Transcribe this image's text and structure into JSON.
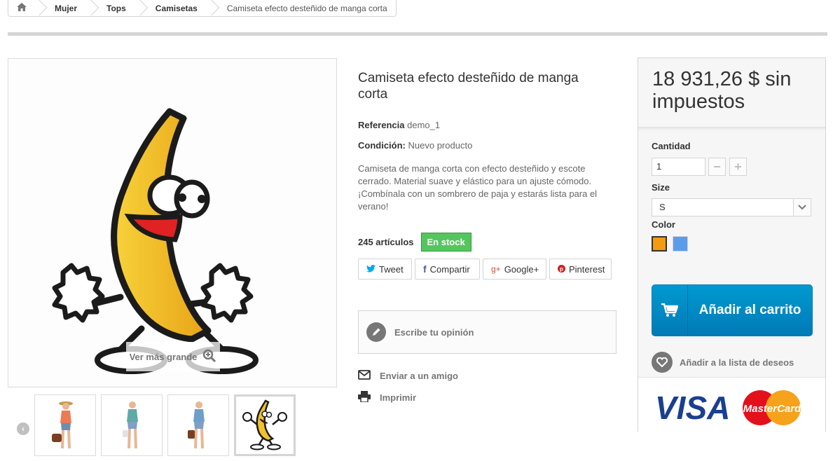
{
  "breadcrumb": {
    "home_icon": "home-icon",
    "items": [
      "Mujer",
      "Tops",
      "Camisetas"
    ],
    "current": "Camiseta efecto desteñido de manga corta"
  },
  "image": {
    "zoom_label": "Ver más grande",
    "thumbnail_count": 4
  },
  "product": {
    "title": "Camiseta efecto desteñido de manga corta",
    "reference_label": "Referencia",
    "reference_value": "demo_1",
    "condition_label": "Condición:",
    "condition_value": "Nuevo producto",
    "description": "Camiseta de manga corta con efecto desteñido y escote cerrado. Material suave y elástico para un ajuste cómodo. ¡Combínala con un sombrero de paja y estarás lista para el verano!",
    "quantity_text": "245 artículos",
    "stock_badge": "En stock"
  },
  "social": {
    "tweet": "Tweet",
    "share": "Compartir",
    "google": "Google+",
    "pinterest": "Pinterest"
  },
  "review": {
    "label": "Escribe tu opinión"
  },
  "actions": {
    "send_friend": "Enviar a un amigo",
    "print": "Imprimir"
  },
  "buy": {
    "price": "18 931,26 $ sin impuestos",
    "quantity_label": "Cantidad",
    "quantity_value": "1",
    "size_label": "Size",
    "size_value": "S",
    "color_label": "Color",
    "colors": [
      "#f39c11",
      "#5d9cec"
    ],
    "add_to_cart": "Añadir al carrito",
    "wishlist": "Añadir a la lista de deseos",
    "cards": {
      "visa": "VISA",
      "mastercard": "MasterCard"
    }
  },
  "theme": {
    "accent_blue": "#009ad0",
    "stock_green": "#55c65e"
  }
}
